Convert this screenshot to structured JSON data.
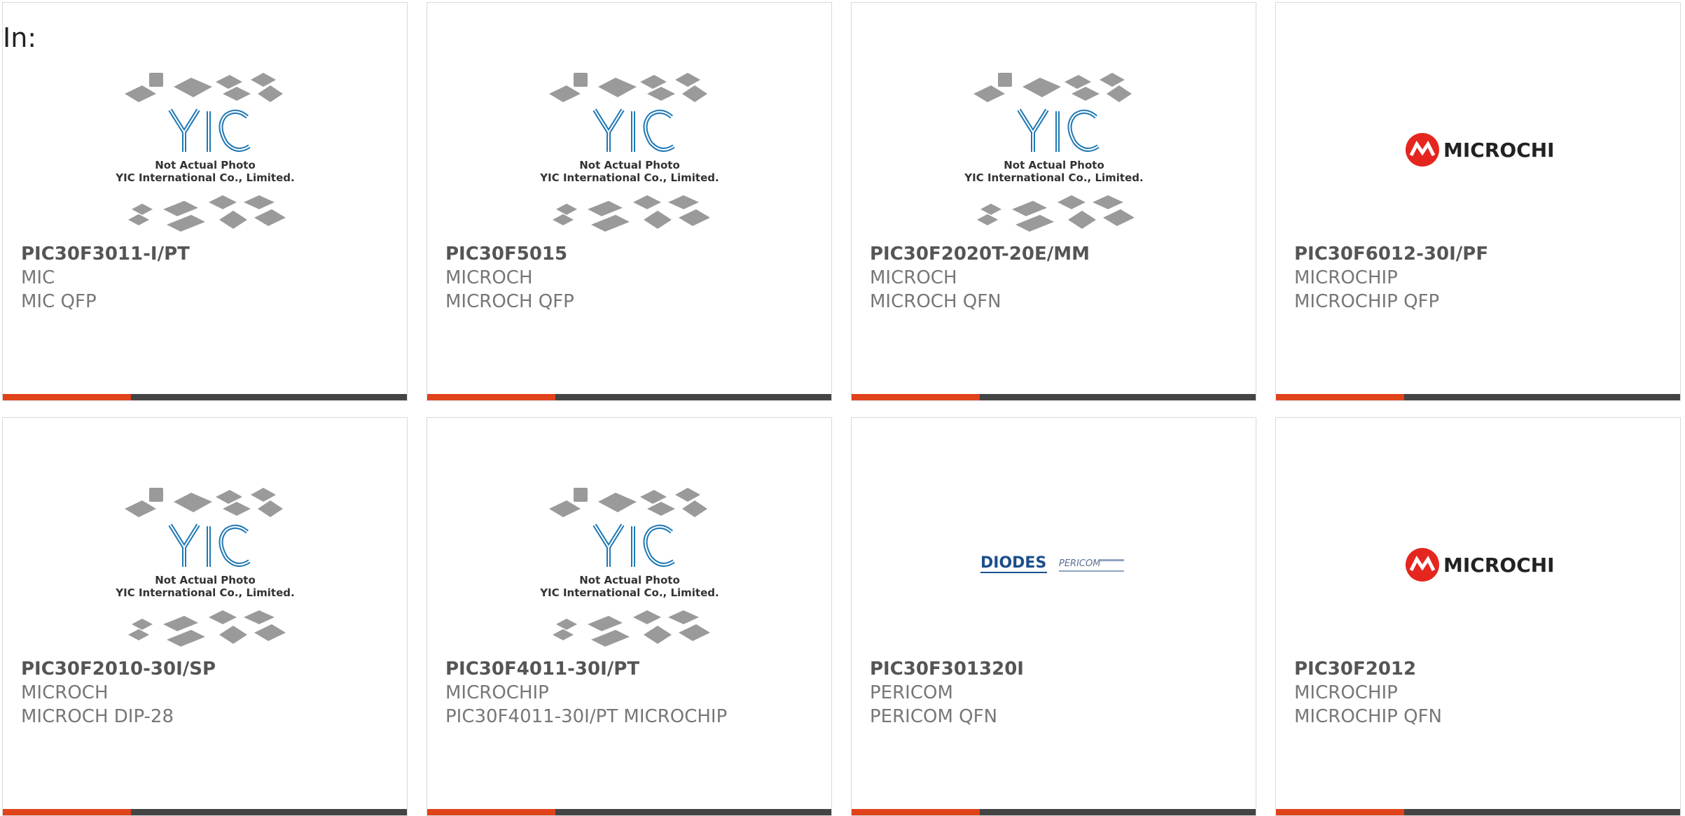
{
  "page": {
    "label": "In:"
  },
  "colors": {
    "accent": "#e0421a",
    "bar": "#444444",
    "border": "#d9d9d9",
    "yic_blue": "#1f78b4",
    "microchip_red": "#e5261f"
  },
  "cards": [
    {
      "part": "PIC30F3011-I/PT",
      "manufacturer": "MIC",
      "description": "MIC QFP",
      "image": "yic-placeholder-photo",
      "photo_caption_1": "Not Actual Photo",
      "photo_caption_2": "YIC International Co., Limited."
    },
    {
      "part": "PIC30F5015",
      "manufacturer": "MICROCH",
      "description": "MICROCH QFP",
      "image": "yic-placeholder-photo",
      "photo_caption_1": "Not Actual Photo",
      "photo_caption_2": "YIC International Co., Limited."
    },
    {
      "part": "PIC30F2020T-20E/MM",
      "manufacturer": "MICROCH",
      "description": "MICROCH QFN",
      "image": "yic-placeholder-photo",
      "photo_caption_1": "Not Actual Photo",
      "photo_caption_2": "YIC International Co., Limited."
    },
    {
      "part": "PIC30F6012-30I/PF",
      "manufacturer": "MICROCHIP",
      "description": "MICROCHIP QFP",
      "image": "microchip-logo",
      "logo_text": "MICROCHIP"
    },
    {
      "part": "PIC30F2010-30I/SP",
      "manufacturer": "MICROCH",
      "description": "MICROCH DIP-28",
      "image": "yic-placeholder-photo",
      "photo_caption_1": "Not Actual Photo",
      "photo_caption_2": "YIC International Co., Limited."
    },
    {
      "part": "PIC30F4011-30I/PT",
      "manufacturer": "MICROCHIP",
      "description": "PIC30F4011-30I/PT MICROCHIP",
      "image": "yic-placeholder-photo",
      "photo_caption_1": "Not Actual Photo",
      "photo_caption_2": "YIC International Co., Limited."
    },
    {
      "part": "PIC30F301320I",
      "manufacturer": "PERICOM",
      "description": "PERICOM QFN",
      "image": "diodes-pericom-logo",
      "logo_text": "DIODES",
      "logo_text_2": "PERICOM"
    },
    {
      "part": "PIC30F2012",
      "manufacturer": "MICROCHIP",
      "description": "MICROCHIP QFN",
      "image": "microchip-logo",
      "logo_text": "MICROCHIP"
    }
  ]
}
